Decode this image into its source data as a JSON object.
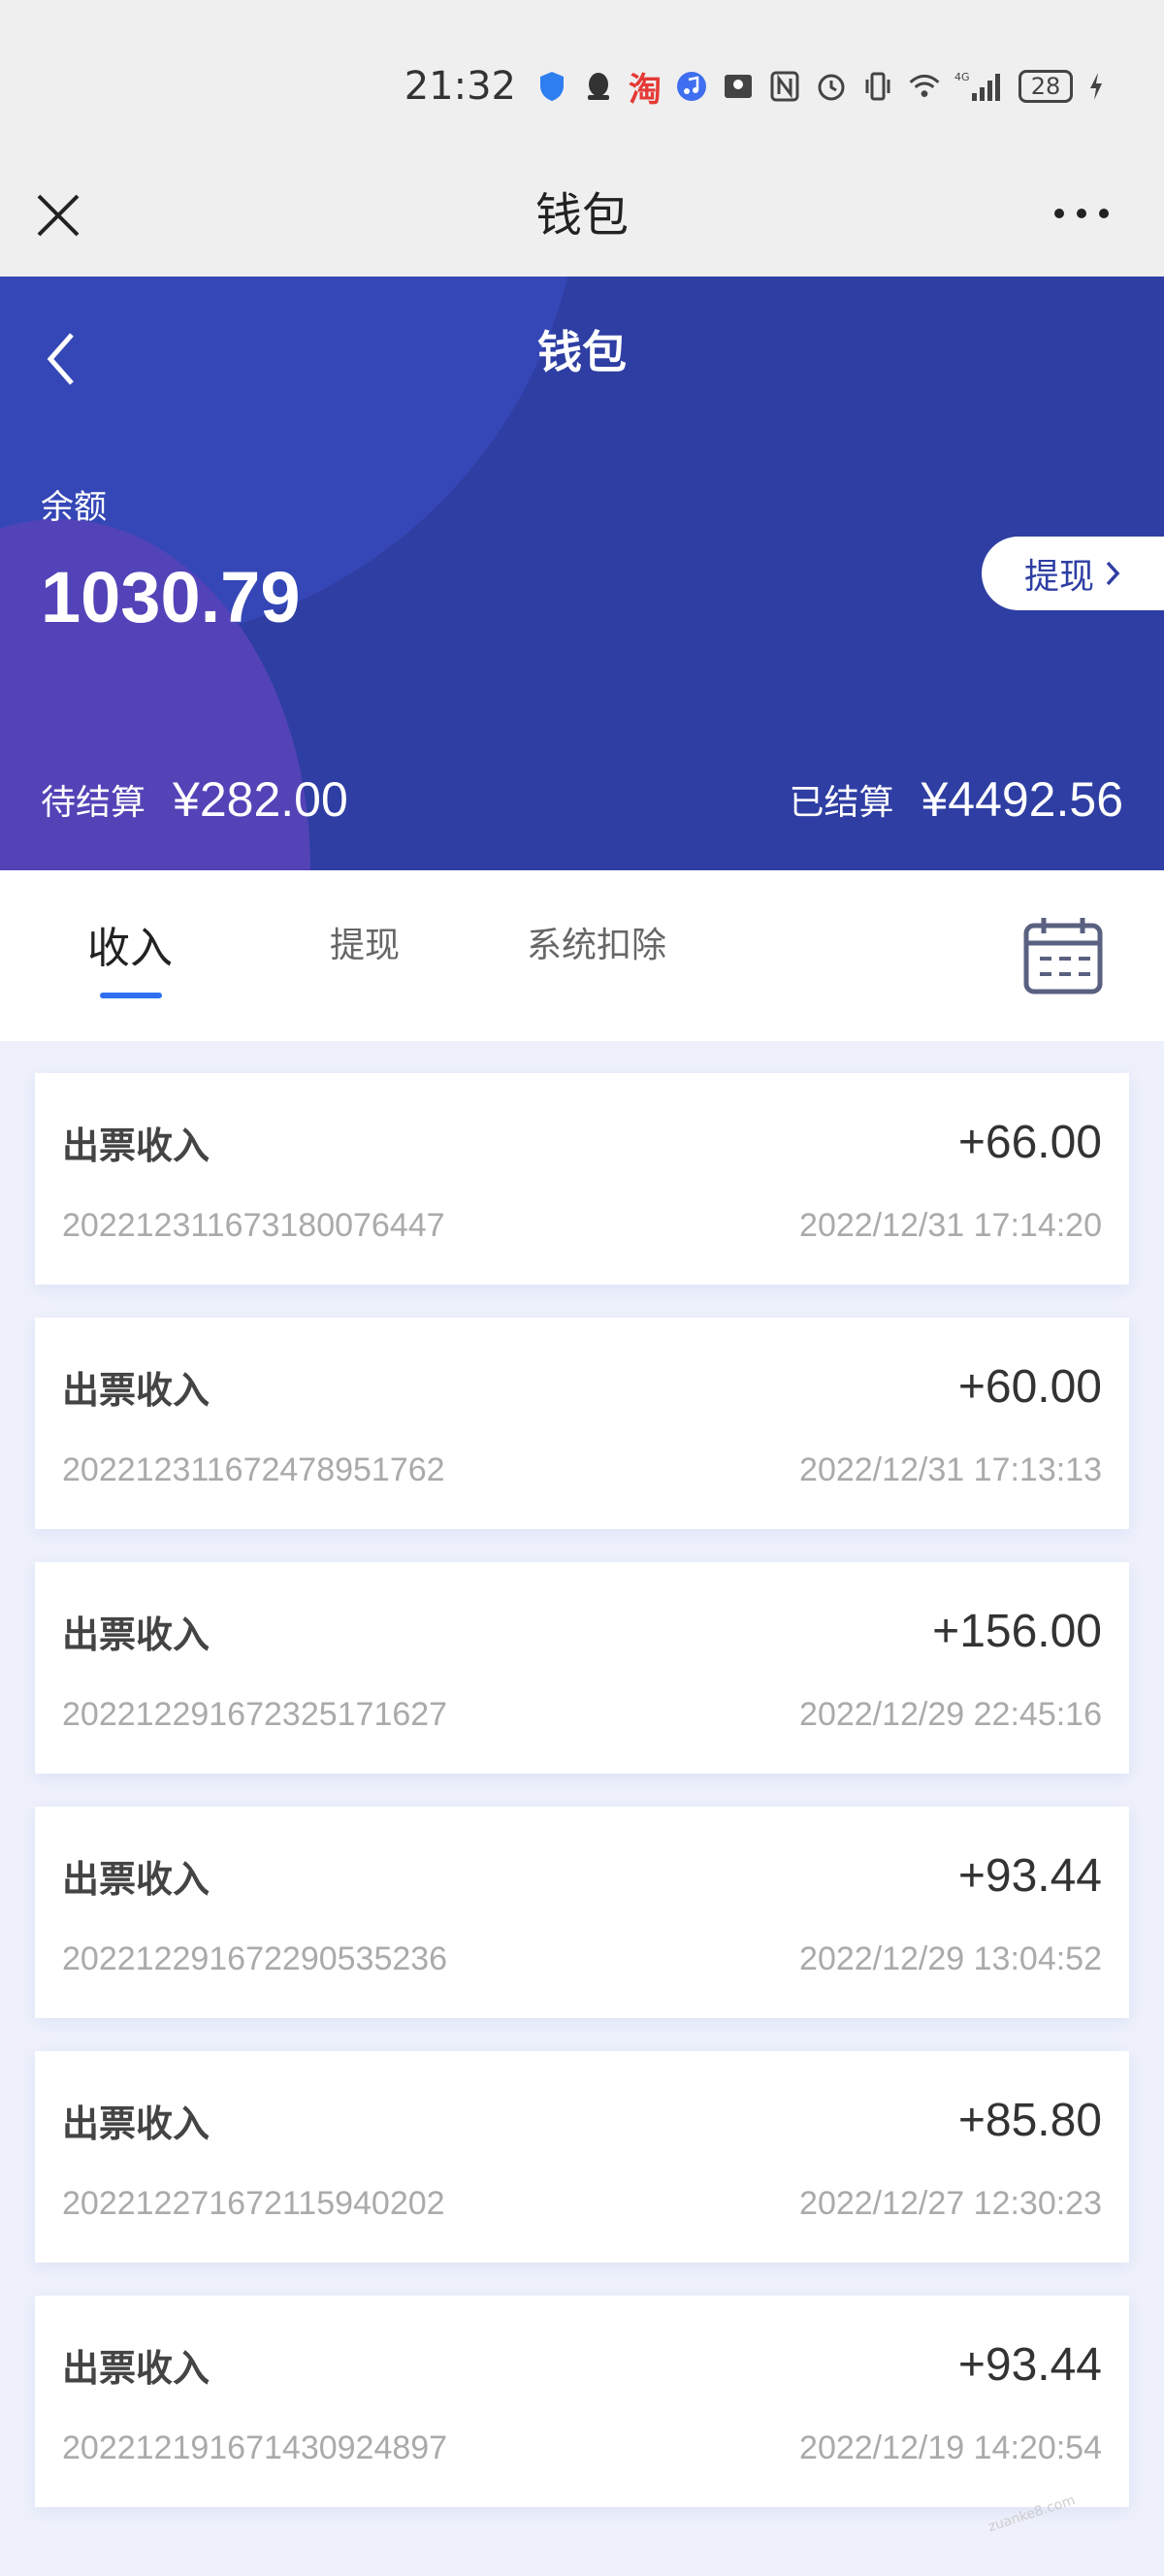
{
  "status_bar": {
    "time": "21:32",
    "taobao_glyph": "淘",
    "network": "4G",
    "battery": "28",
    "icons": [
      "shield-icon",
      "qq-icon",
      "taobao-icon",
      "music-icon",
      "app-icon",
      "nfc-icon",
      "alarm-icon",
      "vibrate-icon",
      "wifi-icon",
      "signal-icon",
      "battery-icon",
      "charging-icon"
    ]
  },
  "nav": {
    "title": "钱包",
    "close_icon": "close-icon",
    "more_icon": "more-icon"
  },
  "header": {
    "title": "钱包",
    "balance_label": "余额",
    "balance": "1030.79",
    "withdraw_label": "提现",
    "pending_label": "待结算",
    "pending_amount": "¥282.00",
    "settled_label": "已结算",
    "settled_amount": "¥4492.56",
    "colors": {
      "bg": "#2e3ea3",
      "accent": "#5543b8"
    }
  },
  "tabs": {
    "items": [
      {
        "label": "收入",
        "active": true
      },
      {
        "label": "提现",
        "active": false
      },
      {
        "label": "系统扣除",
        "active": false
      }
    ],
    "calendar_icon": "calendar-icon",
    "underline_color": "#2f6ff0"
  },
  "transactions": [
    {
      "title": "出票收入",
      "amount": "+66.00",
      "id": "20221231167318007644 7",
      "time": "2022/12/31 17:14:20"
    },
    {
      "title": "出票收入",
      "amount": "+60.00",
      "id": "202212311672478951762",
      "time": "2022/12/31 17:13:13"
    },
    {
      "title": "出票收入",
      "amount": "+156.00",
      "id": "202212291672325171627",
      "time": "2022/12/29 22:45:16"
    },
    {
      "title": "出票收入",
      "amount": "+93.44",
      "id": "202212291672290535236",
      "time": "2022/12/29 13:04:52"
    },
    {
      "title": "出票收入",
      "amount": "+85.80",
      "id": "202212271672115940202",
      "time": "2022/12/27 12:30:23"
    },
    {
      "title": "出票收入",
      "amount": "+93.44",
      "id": "202212191671430924897",
      "time": "2022/12/19 14:20:54"
    }
  ],
  "watermark": "zuanke8.com"
}
